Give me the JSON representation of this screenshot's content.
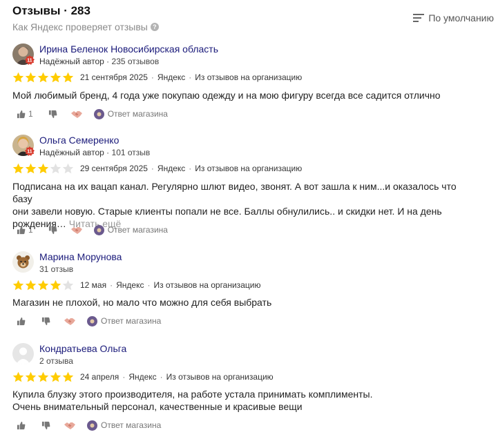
{
  "header": {
    "title": "Отзывы · 283",
    "subtitle": "Как Яндекс проверяет отзывы",
    "sort_label": "По умолчанию"
  },
  "colors": {
    "star_filled": "#ffcc00",
    "star_empty": "#e2e2e2",
    "author_link": "#1a1a7a",
    "badge": "#d83a2c"
  },
  "reviews": [
    {
      "author": "Ирина Беленок Новосибирская область",
      "trusted": "Надёжный автор",
      "count": "235 отзывов",
      "rating": 5,
      "date": "21 сентября 2025",
      "source": "Яндекс",
      "origin": "Из отзывов на организацию",
      "text_lines": [
        "Мой любимый бренд, 4 года уже покупаю одежду и на мою фигуру всегда все садится отлично"
      ],
      "more": "",
      "likes": "1",
      "reply": "Ответ магазина",
      "avatar": "photo"
    },
    {
      "author": "Ольга Семеренко",
      "trusted": "Надёжный автор",
      "count": "101 отзыв",
      "rating": 3,
      "date": "29 сентября 2025",
      "source": "Яндекс",
      "origin": "Из отзывов на организацию",
      "text_lines": [
        "Подписана на их вацап канал. Регулярно шлют видео, звонят. А вот зашла к ним...и оказалось что базу",
        "они завели новую. Старые клиенты попали не все. Баллы обнулились.. и скидки нет. И на день",
        "рождения…"
      ],
      "more": "Читать ещё",
      "likes": "1",
      "reply": "Ответ магазина",
      "avatar": "photo2"
    },
    {
      "author": "Марина Морунова",
      "trusted": "",
      "count": "31 отзыв",
      "rating": 4,
      "date": "12 мая",
      "source": "Яндекс",
      "origin": "Из отзывов на организацию",
      "text_lines": [
        "Магазин не плохой, но мало что можно для себя выбрать"
      ],
      "more": "",
      "likes": "",
      "reply": "Ответ магазина",
      "avatar": "bear"
    },
    {
      "author": "Кондратьева Ольга",
      "trusted": "",
      "count": "2 отзыва",
      "rating": 5,
      "date": "24 апреля",
      "source": "Яндекс",
      "origin": "Из отзывов на организацию",
      "text_lines": [
        "Купила блузку этого производителя, на работе устала принимать комплименты.",
        "Очень внимательный персонал, качественные и красивые вещи"
      ],
      "more": "",
      "likes": "",
      "reply": "Ответ магазина",
      "avatar": "placeholder"
    }
  ]
}
